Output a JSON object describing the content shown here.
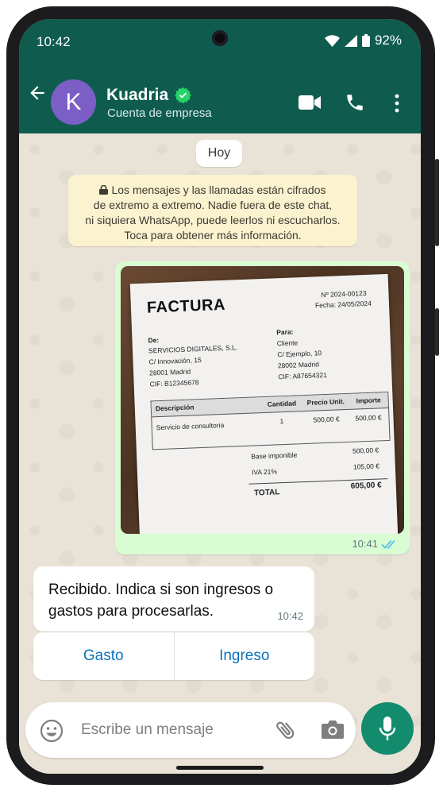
{
  "status_bar": {
    "time": "10:42",
    "battery": "92%"
  },
  "header": {
    "avatar_letter": "K",
    "contact_name": "Kuadria",
    "contact_subtitle": "Cuenta de empresa"
  },
  "chat": {
    "date_label": "Hoy",
    "encryption_notice": [
      "Los mensajes y las llamadas están cifrados",
      "de extremo a extremo. Nadie fuera de este chat,",
      "ni siquiera WhatsApp, puede leerlos ni escucharlos.",
      "Toca para obtener más información."
    ],
    "image_message": {
      "time": "10:41",
      "invoice": {
        "title": "FACTURA",
        "number": "Nº 2024-00123",
        "date": "Fecha: 24/05/2024",
        "from_label": "De:",
        "from_lines": [
          "SERVICIOS DIGITALES, S.L.",
          "C/ Innovación, 15",
          "28001 Madrid",
          "CIF: B12345678"
        ],
        "to_label": "Para:",
        "to_lines": [
          "Cliente",
          "C/ Ejemplo, 10",
          "28002 Madrid",
          "CIF: A87654321"
        ],
        "columns": [
          "Descripción",
          "Cantidad",
          "Precio Unit.",
          "Importe"
        ],
        "row": [
          "Servicio de consultoria",
          "1",
          "500,00 €",
          "500,00 €"
        ],
        "base_label": "Base imponible",
        "base_value": "500,00 €",
        "iva_label": "IVA 21%",
        "iva_value": "105,00 €",
        "total_label": "TOTAL",
        "total_value": "605,00 €"
      }
    },
    "reply_message": {
      "text": "Recibido. Indica si son ingresos o gastos para procesarlas.",
      "time": "10:42"
    },
    "quick_replies": [
      "Gasto",
      "Ingreso"
    ]
  },
  "composer": {
    "placeholder": "Escribe un mensaje"
  },
  "colors": {
    "header": "#0f5c4f",
    "outgoing_bubble": "#d9fdd3",
    "link": "#0c72b8",
    "send_button": "#128c6c"
  }
}
